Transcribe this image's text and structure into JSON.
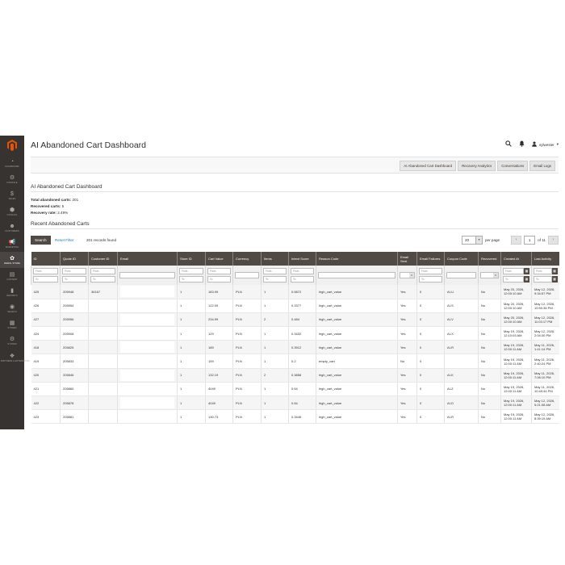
{
  "sidebar": {
    "items": [
      {
        "label": "Dashboard",
        "icon": "dashboard-icon",
        "glyph": "◔"
      },
      {
        "label": "Console",
        "icon": "console-icon",
        "glyph": "⚙"
      },
      {
        "label": "Sales",
        "icon": "sales-icon",
        "glyph": "$"
      },
      {
        "label": "Catalog",
        "icon": "catalog-icon",
        "glyph": "⬢"
      },
      {
        "label": "Customers",
        "icon": "customers-icon",
        "glyph": "☻"
      },
      {
        "label": "Marketing",
        "icon": "marketing-icon",
        "glyph": "📢"
      },
      {
        "label": "Dewal Store",
        "icon": "store-icon",
        "glyph": "✿",
        "active": true
      },
      {
        "label": "Content",
        "icon": "content-icon",
        "glyph": "▤"
      },
      {
        "label": "Reports",
        "icon": "reports-icon",
        "glyph": "▮"
      },
      {
        "label": "Search",
        "icon": "search-nav-icon",
        "glyph": "◉"
      },
      {
        "label": "Stores",
        "icon": "stores-icon",
        "glyph": "▦"
      },
      {
        "label": "System",
        "icon": "system-icon",
        "glyph": "⚙"
      },
      {
        "label": "Find Partners & Extensions",
        "icon": "extensions-icon",
        "glyph": "❖"
      }
    ]
  },
  "header": {
    "title": "AI Abandoned Cart Dashboard",
    "username": "sylwester",
    "user_caret": "▾"
  },
  "tabs": [
    "AI Abandoned Cart Dashboard",
    "Recovery Analytics",
    "Conversations",
    "Email Logs"
  ],
  "summary": {
    "title": "AI Abandoned Cart Dashboard",
    "total_label": "Total abandoned carts:",
    "total_value": "201",
    "recovered_label": "Recovered carts:",
    "recovered_value": "5",
    "rate_label": "Recovery rate:",
    "rate_value": "2.49%"
  },
  "recent": {
    "title": "Recent Abandoned Carts",
    "search_label": "Search",
    "reset_label": "Reset Filter",
    "records_text": "201 records found",
    "per_page_value": "20",
    "per_page_label": "per page",
    "page_value": "1",
    "of_pages": "of 11",
    "prev_glyph": "‹",
    "next_glyph": "›"
  },
  "filters": {
    "from": "From",
    "to": "To"
  },
  "columns": [
    "ID",
    "Quote ID",
    "Customer ID",
    "Email",
    "Store ID",
    "Cart Value",
    "Currency",
    "Items",
    "Intent Score",
    "Reason Code",
    "Email Sent",
    "Email Failures",
    "Coupon Code",
    "Recovered",
    "Created At",
    "Last Activity"
  ],
  "rows": [
    {
      "id": "425",
      "quote": "205948",
      "customer": "36167",
      "store": "1",
      "value": "183.99",
      "currency": "PLN",
      "items": "1",
      "intent": "0.5872",
      "reason": "high_cart_value",
      "sent": "Yes",
      "failures": "0",
      "coupon": "AI-U",
      "recovered": "No",
      "created": "May 20, 2026, 12:00:10 AM",
      "last": "May 12, 2026, 9:34:57 PM"
    },
    {
      "id": "426",
      "quote": "205954",
      "customer": "",
      "store": "1",
      "value": "122.09",
      "currency": "PLN",
      "items": "1",
      "intent": "0.3377",
      "reason": "high_cart_value",
      "sent": "Yes",
      "failures": "0",
      "coupon": "AI-S",
      "recovered": "No",
      "created": "May 20, 2026, 12:00:10 AM",
      "last": "May 12, 2026, 10:50:36 PM"
    },
    {
      "id": "427",
      "quote": "205956",
      "customer": "",
      "store": "1",
      "value": "234.99",
      "currency": "PLN",
      "items": "2",
      "intent": "0.484",
      "reason": "high_cart_value",
      "sent": "Yes",
      "failures": "0",
      "coupon": "AI-V",
      "recovered": "No",
      "created": "May 20, 2026, 12:00:10 AM",
      "last": "May 12, 2026, 11:03:17 PM"
    },
    {
      "id": "424",
      "quote": "205908",
      "customer": "",
      "store": "1",
      "value": "129",
      "currency": "PLN",
      "items": "1",
      "intent": "0.3432",
      "reason": "high_cart_value",
      "sent": "Yes",
      "failures": "0",
      "coupon": "AI-X",
      "recovered": "No",
      "created": "May 19, 2026, 12:10:03 AM",
      "last": "May 12, 2026, 2:04:30 PM"
    },
    {
      "id": "418",
      "quote": "205825",
      "customer": "",
      "store": "1",
      "value": "189",
      "currency": "PLN",
      "items": "1",
      "intent": "0.3912",
      "reason": "high_cart_value",
      "sent": "Yes",
      "failures": "0",
      "coupon": "AI-R",
      "recovered": "No",
      "created": "May 19, 2026, 12:00:11 AM",
      "last": "May 11, 2026, 1:41:14 PM"
    },
    {
      "id": "419",
      "quote": "205833",
      "customer": "",
      "store": "1",
      "value": "159",
      "currency": "PLN",
      "items": "1",
      "intent": "0.2",
      "reason": "empty_cart",
      "sent": "No",
      "failures": "0",
      "coupon": "",
      "recovered": "No",
      "created": "May 19, 2026, 12:00:11 AM",
      "last": "May 11, 2026, 2:40:24 PM"
    },
    {
      "id": "420",
      "quote": "205846",
      "customer": "",
      "store": "1",
      "value": "132.19",
      "currency": "PLN",
      "items": "2",
      "intent": "0.3858",
      "reason": "high_cart_value",
      "sent": "Yes",
      "failures": "0",
      "coupon": "AI-K",
      "recovered": "No",
      "created": "May 19, 2026, 12:00:11 AM",
      "last": "May 11, 2026, 7:06:10 PM"
    },
    {
      "id": "421",
      "quote": "205860",
      "customer": "",
      "store": "1",
      "value": "4049",
      "currency": "PLN",
      "items": "1",
      "intent": "0.64",
      "reason": "high_cart_value",
      "sent": "Yes",
      "failures": "0",
      "coupon": "AI-Z",
      "recovered": "No",
      "created": "May 19, 2026, 12:00:11 AM",
      "last": "May 11, 2026, 10:49:44 PM"
    },
    {
      "id": "422",
      "quote": "205878",
      "customer": "",
      "store": "1",
      "value": "4049",
      "currency": "PLN",
      "items": "1",
      "intent": "0.64",
      "reason": "high_cart_value",
      "sent": "Yes",
      "failures": "0",
      "coupon": "AI-D",
      "recovered": "No",
      "created": "May 19, 2026, 12:00:11 AM",
      "last": "May 12, 2026, 5:21:08 AM"
    },
    {
      "id": "423",
      "quote": "205881",
      "customer": "",
      "store": "1",
      "value": "130.73",
      "currency": "PLN",
      "items": "1",
      "intent": "0.3446",
      "reason": "high_cart_value",
      "sent": "Yes",
      "failures": "0",
      "coupon": "AI-R",
      "recovered": "No",
      "created": "May 19, 2026, 12:00:11 AM",
      "last": "May 12, 2026, 8:39:19 AM"
    }
  ]
}
